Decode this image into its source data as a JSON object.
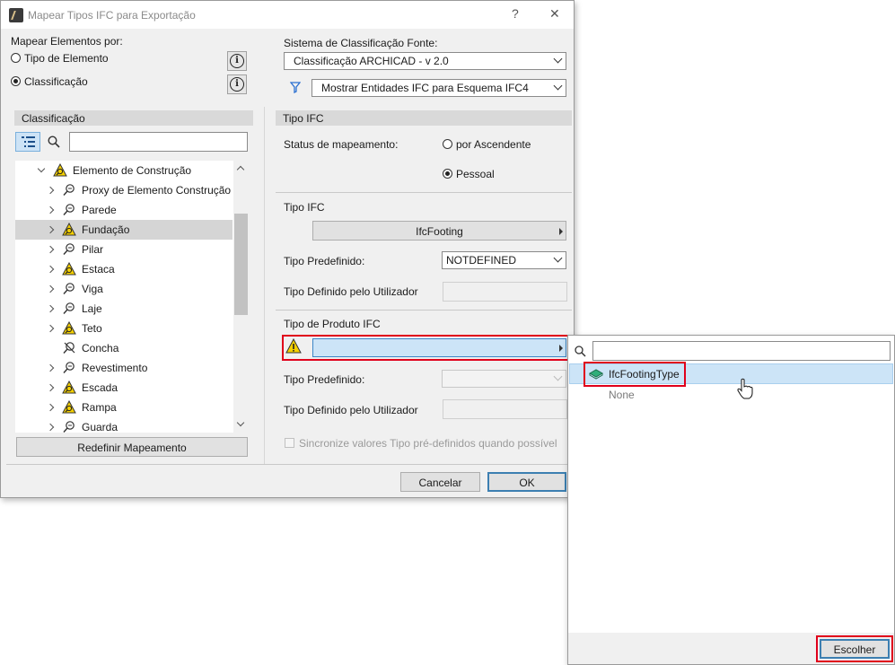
{
  "dialog": {
    "title": "Mapear Tipos IFC para Exportação",
    "help_label": "?",
    "close_label": "✕"
  },
  "map_by": {
    "label": "Mapear Elementos por:",
    "options": [
      "Tipo de Elemento",
      "Classificação"
    ],
    "selected": "Classificação",
    "info_icon": "i"
  },
  "source": {
    "label": "Sistema de Classificação Fonte:",
    "value": "Classificação ARCHICAD - v 2.0",
    "filter_value": "Mostrar Entidades IFC para Esquema IFC4"
  },
  "left_panel": {
    "header": "Classificação",
    "search_placeholder": "",
    "tree": [
      {
        "label": "Elemento de Construção",
        "icon": "warning-icon",
        "expander": "open",
        "selected": false
      },
      {
        "label": "Proxy de Elemento Construção",
        "icon": "mapped-icon",
        "expander": "closed",
        "selected": false
      },
      {
        "label": "Parede",
        "icon": "mapped-icon",
        "expander": "closed",
        "selected": false
      },
      {
        "label": "Fundação",
        "icon": "warning-icon",
        "expander": "closed",
        "selected": true
      },
      {
        "label": "Pilar",
        "icon": "mapped-icon",
        "expander": "closed",
        "selected": false
      },
      {
        "label": "Estaca",
        "icon": "warning-icon",
        "expander": "closed",
        "selected": false
      },
      {
        "label": "Viga",
        "icon": "mapped-icon",
        "expander": "closed",
        "selected": false
      },
      {
        "label": "Laje",
        "icon": "mapped-icon",
        "expander": "closed",
        "selected": false
      },
      {
        "label": "Teto",
        "icon": "warning-icon",
        "expander": "closed",
        "selected": false
      },
      {
        "label": "Concha",
        "icon": "unmapped-icon",
        "expander": "none",
        "selected": false
      },
      {
        "label": "Revestimento",
        "icon": "mapped-icon",
        "expander": "closed",
        "selected": false
      },
      {
        "label": "Escada",
        "icon": "warning-icon",
        "expander": "closed",
        "selected": false
      },
      {
        "label": "Rampa",
        "icon": "warning-icon",
        "expander": "closed",
        "selected": false
      },
      {
        "label": "Guarda",
        "icon": "mapped-icon",
        "expander": "closed",
        "selected": false
      }
    ],
    "reset_button": "Redefinir Mapeamento"
  },
  "right_panel": {
    "header": "Tipo IFC",
    "status_label": "Status de mapeamento:",
    "status_options": [
      "por Ascendente",
      "Pessoal"
    ],
    "status_selected": "Pessoal",
    "ifc_type_section": "Tipo IFC",
    "ifc_type_value": "IfcFooting",
    "predefined_label": "Tipo Predefinido:",
    "predefined_value": "NOTDEFINED",
    "user_defined_label": "Tipo Definido pelo Utilizador",
    "product_section": "Tipo de Produto IFC",
    "product_value": "",
    "product_predefined_label": "Tipo Predefinido:",
    "product_user_defined_label": "Tipo Definido pelo Utilizador",
    "sync_label": "Sincronize valores Tipo pré-definidos quando possível"
  },
  "footer": {
    "cancel": "Cancelar",
    "ok": "OK"
  },
  "popup": {
    "search_placeholder": "",
    "items": [
      {
        "label": "IfcFootingType",
        "icon": "ifc-type-icon",
        "highlighted": true
      },
      {
        "label": "None",
        "icon": "",
        "highlighted": false
      }
    ],
    "choose_button": "Escolher"
  },
  "colors": {
    "highlight": "#cce4f7",
    "annotation_red": "#e0001b",
    "warning_yellow": "#f5d000"
  }
}
